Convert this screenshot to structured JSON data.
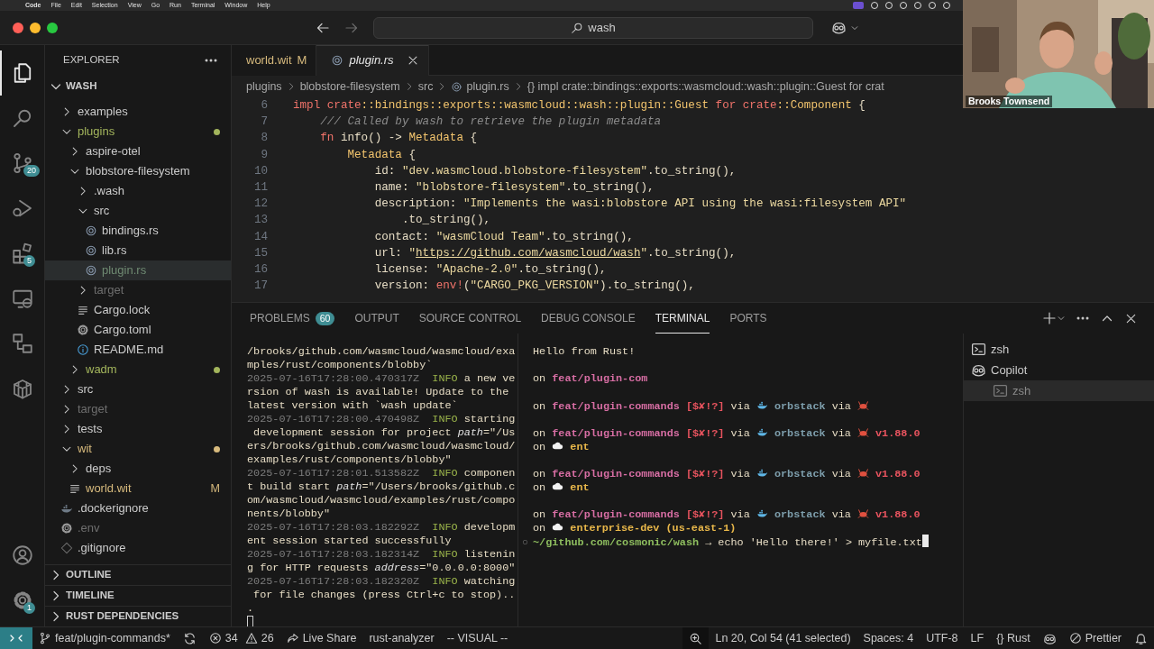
{
  "menu_bar": {
    "app": "Code",
    "items": [
      "File",
      "Edit",
      "Selection",
      "View",
      "Go",
      "Run",
      "Terminal",
      "Window",
      "Help"
    ]
  },
  "title_bar": {
    "search": "wash"
  },
  "video": {
    "kind": "picture",
    "name": "Brooks Townsend"
  },
  "activity_bar": {
    "top": [
      {
        "kind": "files",
        "selected": true
      },
      {
        "kind": "search",
        "selected": false
      },
      {
        "kind": "scm",
        "selected": false,
        "badge": "20"
      },
      {
        "kind": "debug",
        "selected": false
      },
      {
        "kind": "extensions",
        "selected": false,
        "badge": "5"
      },
      {
        "kind": "remote",
        "selected": false
      },
      {
        "kind": "boxes",
        "selected": false
      },
      {
        "kind": "package",
        "selected": false
      }
    ],
    "bottom": [
      {
        "kind": "account"
      },
      {
        "kind": "settings",
        "badge": "1"
      }
    ]
  },
  "sidebar": {
    "title": "EXPLORER",
    "root": "WASH",
    "root_expanded": true,
    "tree": [
      {
        "label": "examples",
        "kind": "folder",
        "expanded": false,
        "selected": false,
        "color": "#cccccc",
        "dot": false
      },
      {
        "label": "plugins",
        "kind": "folder",
        "expanded": true,
        "selected": false,
        "color": "#a3b55c",
        "dot": true,
        "children": [
          {
            "label": "aspire-otel",
            "kind": "folder",
            "expanded": false,
            "selected": false,
            "color": "#cccccc",
            "dot": false
          },
          {
            "label": "blobstore-filesystem",
            "kind": "folder",
            "expanded": true,
            "selected": false,
            "color": "#cccccc",
            "dot": false,
            "children": [
              {
                "label": ".wash",
                "kind": "folder",
                "expanded": false,
                "selected": false,
                "color": "#cccccc",
                "dot": false
              },
              {
                "label": "src",
                "kind": "folder",
                "expanded": true,
                "selected": false,
                "color": "#cccccc",
                "dot": false,
                "children": [
                  {
                    "label": "bindings.rs",
                    "kind": "rust",
                    "selected": false,
                    "color": "#cccccc",
                    "dot": false
                  },
                  {
                    "label": "lib.rs",
                    "kind": "rust",
                    "selected": false,
                    "color": "#cccccc",
                    "dot": false
                  },
                  {
                    "label": "plugin.rs",
                    "kind": "rust",
                    "selected": true,
                    "color": "#6f8a72",
                    "dot": false
                  }
                ]
              },
              {
                "label": "target",
                "kind": "folder",
                "expanded": false,
                "selected": false,
                "color": "#6e6e6e",
                "dot": false
              },
              {
                "label": "Cargo.lock",
                "kind": "lines",
                "selected": false,
                "color": "#cccccc",
                "dot": false
              },
              {
                "label": "Cargo.toml",
                "kind": "settings",
                "selected": false,
                "color": "#cccccc",
                "dot": false
              },
              {
                "label": "README.md",
                "kind": "info",
                "selected": false,
                "color": "#cccccc",
                "dot": false
              }
            ]
          },
          {
            "label": "wadm",
            "kind": "folder",
            "expanded": false,
            "selected": false,
            "color": "#a3b55c",
            "dot": true
          }
        ]
      },
      {
        "label": "src",
        "kind": "folder",
        "expanded": false,
        "selected": false,
        "color": "#cccccc",
        "dot": false
      },
      {
        "label": "target",
        "kind": "folder",
        "expanded": false,
        "selected": false,
        "color": "#6e6e6e",
        "dot": false
      },
      {
        "label": "tests",
        "kind": "folder",
        "expanded": false,
        "selected": false,
        "color": "#cccccc",
        "dot": false
      },
      {
        "label": "wit",
        "kind": "folder",
        "expanded": true,
        "selected": false,
        "color": "#d7ba7d",
        "dot": true,
        "children": [
          {
            "label": "deps",
            "kind": "folder",
            "expanded": false,
            "selected": false,
            "color": "#cccccc",
            "dot": false
          },
          {
            "label": "world.wit",
            "kind": "lines",
            "selected": false,
            "color": "#d7ba7d",
            "dot": false,
            "decoration": "M"
          }
        ]
      },
      {
        "label": ".dockerignore",
        "kind": "docker",
        "selected": false,
        "color": "#cccccc",
        "dot": false
      },
      {
        "label": ".env",
        "kind": "settings",
        "selected": false,
        "color": "#6e6e6e",
        "dot": false
      },
      {
        "label": ".gitignore",
        "kind": "git",
        "selected": false,
        "color": "#cccccc",
        "dot": false
      }
    ],
    "sections": [
      {
        "label": "OUTLINE",
        "expanded": false
      },
      {
        "label": "TIMELINE",
        "expanded": false
      },
      {
        "label": "RUST DEPENDENCIES",
        "expanded": false
      }
    ]
  },
  "editor": {
    "tabs": [
      {
        "label": "world.wit",
        "selected": false,
        "preview": false,
        "color": "#d7ba7d",
        "decoration": "M"
      },
      {
        "label": "plugin.rs",
        "selected": true,
        "preview": true,
        "color": "#e8e8e8",
        "kind": "rust"
      }
    ],
    "breadcrumbs": [
      {
        "label": "plugins",
        "kind": "folder"
      },
      {
        "label": "blobstore-filesystem",
        "kind": "folder"
      },
      {
        "label": "src",
        "kind": "folder"
      },
      {
        "label": "plugin.rs",
        "kind": "rust"
      },
      {
        "label": "{} impl crate::bindings::exports::wasmcloud::wash::plugin::Guest for crat",
        "kind": "symbol"
      }
    ],
    "lines": [
      {
        "number": "6",
        "tokens": [
          {
            "kind": "kw",
            "text": "impl crate"
          },
          {
            "kind": "ty",
            "text": "::bindings::exports::wasmcloud::wash::plugin::Guest "
          },
          {
            "kind": "kw",
            "text": "for crate"
          },
          {
            "kind": "ty",
            "text": "::Component "
          },
          {
            "kind": "plain",
            "text": "{"
          }
        ]
      },
      {
        "number": "7",
        "tokens": [
          {
            "kind": "comment",
            "text": "    /// Called by wash to retrieve the plugin metadata"
          }
        ]
      },
      {
        "number": "8",
        "tokens": [
          {
            "kind": "kw",
            "text": "    fn "
          },
          {
            "kind": "plain",
            "text": "info() -> "
          },
          {
            "kind": "ty",
            "text": "Metadata "
          },
          {
            "kind": "plain",
            "text": "{"
          }
        ]
      },
      {
        "number": "9",
        "tokens": [
          {
            "kind": "ty",
            "text": "        Metadata "
          },
          {
            "kind": "plain",
            "text": "{"
          }
        ]
      },
      {
        "number": "10",
        "tokens": [
          {
            "kind": "plain",
            "text": "            id: "
          },
          {
            "kind": "str",
            "text": "\"dev.wasmcloud.blobstore-filesystem\""
          },
          {
            "kind": "plain",
            "text": ".to_string(),"
          }
        ]
      },
      {
        "number": "11",
        "tokens": [
          {
            "kind": "plain",
            "text": "            name: "
          },
          {
            "kind": "str",
            "text": "\"blobstore-filesystem\""
          },
          {
            "kind": "plain",
            "text": ".to_string(),"
          }
        ]
      },
      {
        "number": "12",
        "tokens": [
          {
            "kind": "plain",
            "text": "            description: "
          },
          {
            "kind": "str",
            "text": "\"Implements the wasi:blobstore API using the wasi:filesystem API\""
          }
        ]
      },
      {
        "number": "13",
        "tokens": [
          {
            "kind": "plain",
            "text": "                .to_string(),"
          }
        ]
      },
      {
        "number": "14",
        "tokens": [
          {
            "kind": "plain",
            "text": "            contact: "
          },
          {
            "kind": "str",
            "text": "\"wasmCloud Team\""
          },
          {
            "kind": "plain",
            "text": ".to_string(),"
          }
        ]
      },
      {
        "number": "15",
        "tokens": [
          {
            "kind": "plain",
            "text": "            url: "
          },
          {
            "kind": "str",
            "text": "\""
          },
          {
            "kind": "link",
            "text": "https://github.com/wasmcloud/wash"
          },
          {
            "kind": "str",
            "text": "\""
          },
          {
            "kind": "plain",
            "text": ".to_string(),"
          }
        ]
      },
      {
        "number": "16",
        "tokens": [
          {
            "kind": "plain",
            "text": "            license: "
          },
          {
            "kind": "str",
            "text": "\"Apache-2.0\""
          },
          {
            "kind": "plain",
            "text": ".to_string(),"
          }
        ]
      },
      {
        "number": "17",
        "tokens": [
          {
            "kind": "plain",
            "text": "            version: "
          },
          {
            "kind": "kw",
            "text": "env!"
          },
          {
            "kind": "plain",
            "text": "("
          },
          {
            "kind": "str",
            "text": "\"CARGO_PKG_VERSION\""
          },
          {
            "kind": "plain",
            "text": ").to_string(),"
          }
        ]
      }
    ]
  },
  "panel": {
    "tabs": [
      {
        "label": "PROBLEMS",
        "selected": false,
        "badge": "60"
      },
      {
        "label": "OUTPUT",
        "selected": false
      },
      {
        "label": "SOURCE CONTROL",
        "selected": false
      },
      {
        "label": "DEBUG CONSOLE",
        "selected": false
      },
      {
        "label": "TERMINAL",
        "selected": true
      },
      {
        "label": "PORTS",
        "selected": false
      }
    ],
    "left_terminal": [
      [
        {
          "kind": "plain",
          "text": "/brooks/github.com/wasmcloud/wasmcloud/exa"
        }
      ],
      [
        {
          "kind": "plain",
          "text": "mples/rust/components/blobby`"
        }
      ],
      [
        {
          "kind": "ts",
          "text": "2025-07-16T17:28:00.470317Z  "
        },
        {
          "kind": "info",
          "text": "INFO"
        },
        {
          "kind": "plain",
          "text": " a new ve"
        }
      ],
      [
        {
          "kind": "plain",
          "text": "rsion of wash is available! Update to the"
        }
      ],
      [
        {
          "kind": "plain",
          "text": "latest version with `wash update`"
        }
      ],
      [
        {
          "kind": "ts",
          "text": "2025-07-16T17:28:00.470498Z  "
        },
        {
          "kind": "info",
          "text": "INFO"
        },
        {
          "kind": "plain",
          "text": " starting"
        }
      ],
      [
        {
          "kind": "plain",
          "text": " development session for project "
        },
        {
          "kind": "em",
          "text": "path"
        },
        {
          "kind": "plain",
          "text": "=\"/Us"
        }
      ],
      [
        {
          "kind": "plain",
          "text": "ers/brooks/github.com/wasmcloud/wasmcloud/"
        }
      ],
      [
        {
          "kind": "plain",
          "text": "examples/rust/components/blobby\""
        }
      ],
      [
        {
          "kind": "ts",
          "text": "2025-07-16T17:28:01.513582Z  "
        },
        {
          "kind": "info",
          "text": "INFO"
        },
        {
          "kind": "plain",
          "text": " componen"
        }
      ],
      [
        {
          "kind": "plain",
          "text": "t build start "
        },
        {
          "kind": "em",
          "text": "path"
        },
        {
          "kind": "plain",
          "text": "=\"/Users/brooks/github.c"
        }
      ],
      [
        {
          "kind": "plain",
          "text": "om/wasmcloud/wasmcloud/examples/rust/compo"
        }
      ],
      [
        {
          "kind": "plain",
          "text": "nents/blobby\""
        }
      ],
      [
        {
          "kind": "ts",
          "text": "2025-07-16T17:28:03.182292Z  "
        },
        {
          "kind": "info",
          "text": "INFO"
        },
        {
          "kind": "plain",
          "text": " developm"
        }
      ],
      [
        {
          "kind": "plain",
          "text": "ent session started successfully"
        }
      ],
      [
        {
          "kind": "ts",
          "text": "2025-07-16T17:28:03.182314Z  "
        },
        {
          "kind": "info",
          "text": "INFO"
        },
        {
          "kind": "plain",
          "text": " listenin"
        }
      ],
      [
        {
          "kind": "plain",
          "text": "g for HTTP requests "
        },
        {
          "kind": "em",
          "text": "address"
        },
        {
          "kind": "plain",
          "text": "=\"0.0.0.0:8000\""
        }
      ],
      [
        {
          "kind": "ts",
          "text": "2025-07-16T17:28:03.182320Z  "
        },
        {
          "kind": "info",
          "text": "INFO"
        },
        {
          "kind": "plain",
          "text": " watching"
        }
      ],
      [
        {
          "kind": "plain",
          "text": " for file changes (press Ctrl+c to stop).."
        }
      ],
      [
        {
          "kind": "plain",
          "text": "."
        }
      ],
      [
        {
          "kind": "cursor"
        }
      ]
    ],
    "right_terminal": [
      [
        [
          {
            "kind": "plain",
            "text": "Hello from Rust!"
          }
        ]
      ],
      [
        [
          {
            "kind": "plain",
            "text": "on "
          },
          {
            "kind": "branch",
            "text": "feat/plugin-com"
          }
        ]
      ],
      [
        [
          {
            "kind": "plain",
            "text": "on "
          },
          {
            "kind": "branch",
            "text": "feat/plugin-commands "
          },
          {
            "kind": "status",
            "text": "[$✘!?]"
          },
          {
            "kind": "plain",
            "text": " via "
          },
          {
            "kind": "whale"
          },
          {
            "kind": "orb",
            "text": " orbstack"
          },
          {
            "kind": "plain",
            "text": " via "
          },
          {
            "kind": "crab"
          }
        ]
      ],
      [
        [
          {
            "kind": "plain",
            "text": "on "
          },
          {
            "kind": "branch",
            "text": "feat/plugin-commands "
          },
          {
            "kind": "status",
            "text": "[$✘!?]"
          },
          {
            "kind": "plain",
            "text": " via "
          },
          {
            "kind": "whale"
          },
          {
            "kind": "orb",
            "text": " orbstack"
          },
          {
            "kind": "plain",
            "text": " via "
          },
          {
            "kind": "crab"
          },
          {
            "kind": "status",
            "text": " v1.88.0"
          }
        ],
        [
          {
            "kind": "plain",
            "text": "on "
          },
          {
            "kind": "cloud"
          },
          {
            "kind": "ent",
            "text": " ent"
          }
        ]
      ],
      [
        [
          {
            "kind": "plain",
            "text": "on "
          },
          {
            "kind": "branch",
            "text": "feat/plugin-commands "
          },
          {
            "kind": "status",
            "text": "[$✘!?]"
          },
          {
            "kind": "plain",
            "text": " via "
          },
          {
            "kind": "whale"
          },
          {
            "kind": "orb",
            "text": " orbstack"
          },
          {
            "kind": "plain",
            "text": " via "
          },
          {
            "kind": "crab"
          },
          {
            "kind": "status",
            "text": " v1.88.0"
          }
        ],
        [
          {
            "kind": "plain",
            "text": "on "
          },
          {
            "kind": "cloud"
          },
          {
            "kind": "ent",
            "text": " ent"
          }
        ]
      ],
      [
        [
          {
            "kind": "plain",
            "text": "on "
          },
          {
            "kind": "branch",
            "text": "feat/plugin-commands "
          },
          {
            "kind": "status",
            "text": "[$✘!?]"
          },
          {
            "kind": "plain",
            "text": " via "
          },
          {
            "kind": "whale"
          },
          {
            "kind": "orb",
            "text": " orbstack"
          },
          {
            "kind": "plain",
            "text": " via "
          },
          {
            "kind": "crab"
          },
          {
            "kind": "status",
            "text": " v1.88.0"
          }
        ],
        [
          {
            "kind": "plain",
            "text": "on "
          },
          {
            "kind": "cloud"
          },
          {
            "kind": "ent",
            "text": " enterprise-dev (us-east-1)"
          }
        ],
        [
          {
            "kind": "mark",
            "text": "○"
          },
          {
            "kind": "path",
            "text": "~/github.com/cosmonic/wash"
          },
          {
            "kind": "plain",
            "text": " → echo 'Hello there!' > myfile.txt"
          },
          {
            "kind": "cursor"
          }
        ]
      ]
    ],
    "sessions": [
      {
        "label": "zsh",
        "kind": "terminal",
        "selected": false
      },
      {
        "label": "Copilot",
        "kind": "copilot",
        "selected": false,
        "children": [
          {
            "label": "zsh",
            "kind": "terminal",
            "selected": true
          }
        ]
      }
    ]
  },
  "status_bar": {
    "left": [
      {
        "kind": "remote"
      },
      {
        "kind": "branch",
        "text": "feat/plugin-commands*"
      },
      {
        "kind": "sync"
      },
      {
        "kind": "problems",
        "errors": "34",
        "warnings": "26"
      },
      {
        "kind": "share",
        "text": "Live Share"
      },
      {
        "kind": "text",
        "text": "rust-analyzer"
      },
      {
        "kind": "text",
        "text": "-- VISUAL --"
      }
    ],
    "right": [
      {
        "kind": "zoom"
      },
      {
        "kind": "text",
        "text": "Ln 20, Col 54 (41 selected)"
      },
      {
        "kind": "text",
        "text": "Spaces: 4"
      },
      {
        "kind": "text",
        "text": "UTF-8"
      },
      {
        "kind": "text",
        "text": "LF"
      },
      {
        "kind": "text",
        "text": "{} Rust"
      },
      {
        "kind": "copilot"
      },
      {
        "kind": "blocked",
        "text": "Prettier"
      },
      {
        "kind": "bell"
      }
    ]
  }
}
